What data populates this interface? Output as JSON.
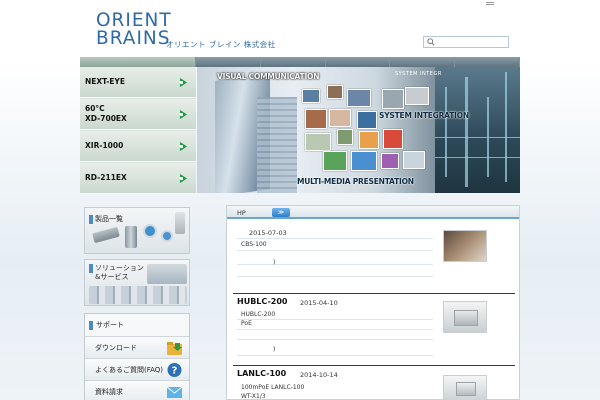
{
  "header": {
    "logo_line1": "ORIENT",
    "logo_line2": "BRAINS",
    "logo_sub": "オリエント ブレイン 株式会社",
    "search_placeholder": ""
  },
  "left_menu": [
    {
      "line1": "NEXT-EYE",
      "line2": ""
    },
    {
      "line1": "60°C",
      "line2": "XD-700EX"
    },
    {
      "line1": "XIR-1000",
      "line2": ""
    },
    {
      "line1": "RD-211EX",
      "line2": ""
    }
  ],
  "banner": {
    "title1": "VISUAL COMMUNICATION",
    "title2": "SYSTEM INTEGRATION",
    "title3": "MULTI-MEDIA PRESENTATION",
    "small": "SYSTEM INTEGR"
  },
  "sidebar": {
    "products": "製品一覧",
    "solution_line1": "ソリューション",
    "solution_line2": "&サービス",
    "support": "サポート",
    "download": "ダウンロード",
    "faq": "よくあるご質問(FAQ)",
    "request": "資料請求"
  },
  "news_panel": {
    "tab_label": "HP",
    "tab_button": "≫",
    "items": [
      {
        "title": "",
        "date": "2015-07-03",
        "lines": [
          "CBS-100",
          ")"
        ]
      },
      {
        "title": "HUBLC-200",
        "date": "2015-04-10",
        "lines": [
          "HUBLC-200",
          "PoE",
          ")"
        ]
      },
      {
        "title": "LANLC-100",
        "date": "2014-10-14",
        "lines": [
          "100mPoE LANLC-100",
          "WT-X1/3"
        ]
      }
    ]
  },
  "colors": {
    "brand_blue": "#2f6aa6",
    "arrow_green": "#1f9a3a",
    "tab_accent": "#6aa5d8"
  }
}
